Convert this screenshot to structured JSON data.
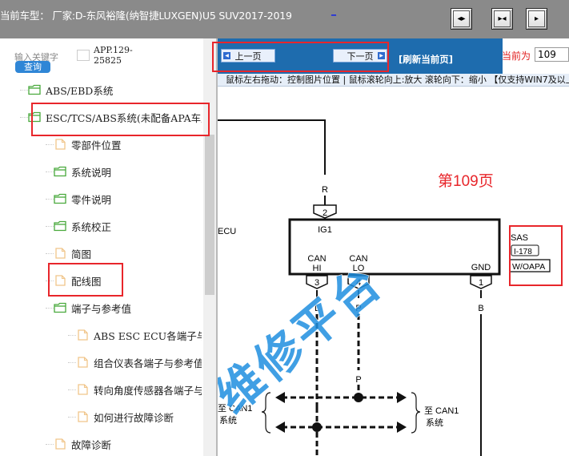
{
  "header": {
    "title": "当前车型： 厂家:D-东风裕隆(纳智捷LUXGEN)U5 SUV2017-2019",
    "link": "_"
  },
  "left_panel": {
    "search_label": "输入关键字",
    "search_button": "查询",
    "app_code": "APP.129-25825",
    "tree": [
      {
        "label": "ABS/EBD系统",
        "icon": "folder-open-icon"
      },
      {
        "label": "ESC/TCS/ABS系统(未配备APA车型)",
        "icon": "folder-open-icon"
      },
      {
        "label": "零部件位置",
        "icon": "document-icon"
      },
      {
        "label": "系统说明",
        "icon": "folder-open-icon"
      },
      {
        "label": "零件说明",
        "icon": "folder-open-icon"
      },
      {
        "label": "系统校正",
        "icon": "folder-open-icon"
      },
      {
        "label": "简图",
        "icon": "document-icon"
      },
      {
        "label": "配线图",
        "icon": "document-icon"
      },
      {
        "label": "端子与参考值",
        "icon": "folder-open-icon"
      },
      {
        "label": "ABS ESC ECU各端子与参考值",
        "icon": "document-icon"
      },
      {
        "label": "组合仪表各端子与参考值",
        "icon": "document-icon"
      },
      {
        "label": "转向角度传感器各端子与参考值",
        "icon": "document-icon"
      },
      {
        "label": "如何进行故障诊断",
        "icon": "document-icon"
      },
      {
        "label": "故障诊断",
        "icon": "document-icon"
      }
    ]
  },
  "nav": {
    "prev_label": "上一页",
    "next_label": "下一页",
    "refresh_label": "[刷新当前页]",
    "current_page_label": "当前为",
    "current_page_value": "109",
    "hint": "鼠标左右拖动：控制图片位置 | 鼠标滚轮向上:放大   滚轮向下：缩小 【仅支持WIN7及以上系统】"
  },
  "diagram": {
    "page_label": "第109页",
    "ecu_label": "ECU",
    "wire_r": "R",
    "wire_l": "L",
    "wire_p_top": "P",
    "wire_p": "P",
    "wire_b": "B",
    "pin_2": "2",
    "pin_3": "3",
    "pin_4": "4",
    "pin_1": "1",
    "ig1": "IG1",
    "can_hi_1": "CAN",
    "can_hi_2": "HI",
    "can_lo_1": "CAN",
    "can_lo_2": "LO",
    "gnd": "GND",
    "sas": "SAS",
    "sas_code": "I-178",
    "sas_variant": "W/OAPA",
    "to_can1_left_1": "至 CAN1",
    "to_can1_left_2": "系统",
    "to_can1_right_1": "至 CAN1",
    "to_can1_right_2": "系统",
    "watermark": "维修平台"
  },
  "colors": {
    "topbar": "#8a8a8a",
    "navbar": "#1e6cae",
    "highlight": "#e8262b",
    "folder": "#49a93c",
    "document": "#f0c58a",
    "watermark": "#1f8fe0"
  }
}
